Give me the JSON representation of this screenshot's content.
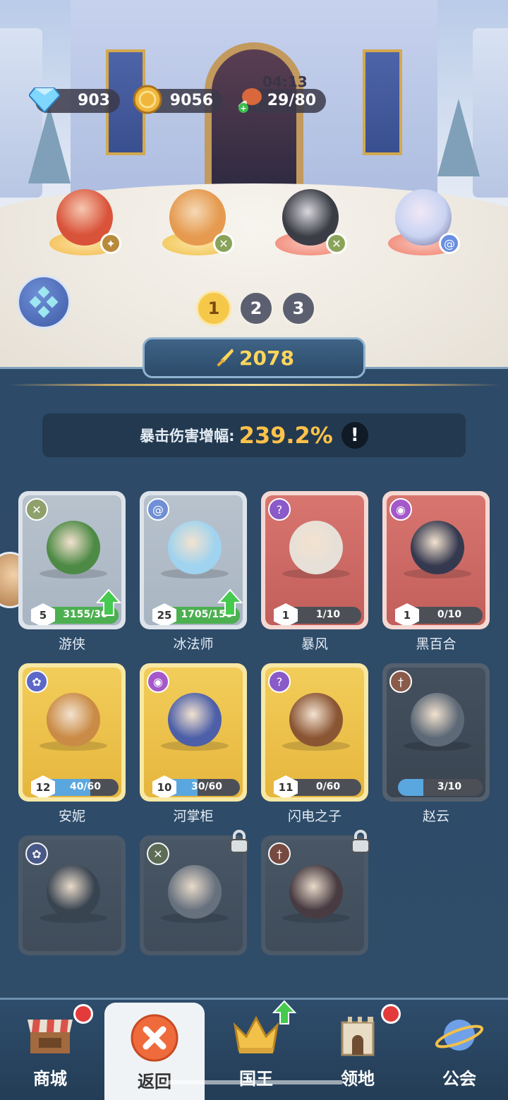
{
  "resources": {
    "diamonds": "903",
    "coins": "9056",
    "stamina": "29/80",
    "stamina_timer": "04:13"
  },
  "team_tabs": [
    "1",
    "2",
    "3"
  ],
  "active_team": "1",
  "power": "2078",
  "stat": {
    "label": "暴击伤害增幅:",
    "value": "239.2%",
    "info": "!"
  },
  "heroes_row": [
    {
      "name": "mermaid",
      "ring": "#f3b94a",
      "body": "#d9533a",
      "tag": "#b88a3a",
      "tag_icon": "wing-icon"
    },
    {
      "name": "raccoon",
      "ring": "#f0c24b",
      "body": "#e59a4f",
      "tag": "#8aa35a",
      "tag_icon": "crosshair-icon"
    },
    {
      "name": "husky",
      "ring": "#f0806d",
      "body": "#3b3d46",
      "tag": "#8aa35a",
      "tag_icon": "crosshair-icon"
    },
    {
      "name": "fan-girl",
      "ring": "#f0806d",
      "body": "#c9d3f2",
      "tag": "#6a8fe0",
      "tag_icon": "spiral-icon"
    }
  ],
  "cards": [
    {
      "name": "游侠",
      "style": "grey",
      "class_icon": "crosshair-icon",
      "class_color": "#8ea06b",
      "level": "5",
      "progress": "3155/30",
      "fill": 1.0,
      "upgrade": true,
      "portrait": "#4d8a45"
    },
    {
      "name": "冰法师",
      "style": "grey",
      "class_icon": "spiral-icon",
      "class_color": "#6f8fd6",
      "level": "25",
      "progress": "1705/150",
      "fill": 1.0,
      "upgrade": true,
      "portrait": "#9fd3ef"
    },
    {
      "name": "暴风",
      "style": "red",
      "class_icon": "question-icon",
      "class_color": "#8a5ac9",
      "level": "1",
      "progress": "1/10",
      "fill": 0.1,
      "upgrade": false,
      "portrait": "#e6e0d8"
    },
    {
      "name": "黑百合",
      "style": "red",
      "class_icon": "eye-icon",
      "class_color": "#a558c9",
      "level": "1",
      "progress": "0/10",
      "fill": 0.0,
      "upgrade": false,
      "portrait": "#35394f"
    },
    {
      "name": "安妮",
      "style": "gold",
      "class_icon": "paw-icon",
      "class_color": "#5b68c7",
      "level": "12",
      "progress": "40/60",
      "fill": 0.67,
      "upgrade": false,
      "portrait": "#c98b45"
    },
    {
      "name": "河掌柜",
      "style": "gold",
      "class_icon": "eye-icon",
      "class_color": "#a558c9",
      "level": "10",
      "progress": "30/60",
      "fill": 0.5,
      "upgrade": false,
      "portrait": "#4c5fa8"
    },
    {
      "name": "闪电之子",
      "style": "gold",
      "class_icon": "question-icon",
      "class_color": "#8a5ac9",
      "level": "11",
      "progress": "0/60",
      "fill": 0.0,
      "upgrade": false,
      "portrait": "#8a5533"
    },
    {
      "name": "赵云",
      "style": "dark",
      "class_icon": "sword-icon",
      "class_color": "#8a5a4a",
      "level": "",
      "progress": "3/10",
      "fill": 0.3,
      "upgrade": false,
      "portrait": "#5d6976"
    },
    {
      "name": "",
      "style": "locked",
      "class_icon": "paw-icon",
      "class_color": "#4a5a8a",
      "level": "",
      "progress": "",
      "fill": 0,
      "upgrade": false,
      "portrait": "#3a4450",
      "locked": false
    },
    {
      "name": "",
      "style": "locked",
      "class_icon": "crosshair-icon",
      "class_color": "#5f6e55",
      "level": "",
      "progress": "",
      "fill": 0,
      "upgrade": false,
      "portrait": "#6b7480",
      "locked": true
    },
    {
      "name": "",
      "style": "locked",
      "class_icon": "sword-icon",
      "class_color": "#7a4a3e",
      "level": "",
      "progress": "",
      "fill": 0,
      "upgrade": false,
      "portrait": "#4a3b40",
      "locked": true
    }
  ],
  "nav": [
    {
      "label": "商城",
      "icon": "shop-icon",
      "badge": "red"
    },
    {
      "label": "返回",
      "icon": "close-icon",
      "badge": "",
      "active": true
    },
    {
      "label": "国王",
      "icon": "crown-icon",
      "badge": "up"
    },
    {
      "label": "领地",
      "icon": "castle-icon",
      "badge": "red"
    },
    {
      "label": "公会",
      "icon": "planet-icon",
      "badge": ""
    }
  ]
}
